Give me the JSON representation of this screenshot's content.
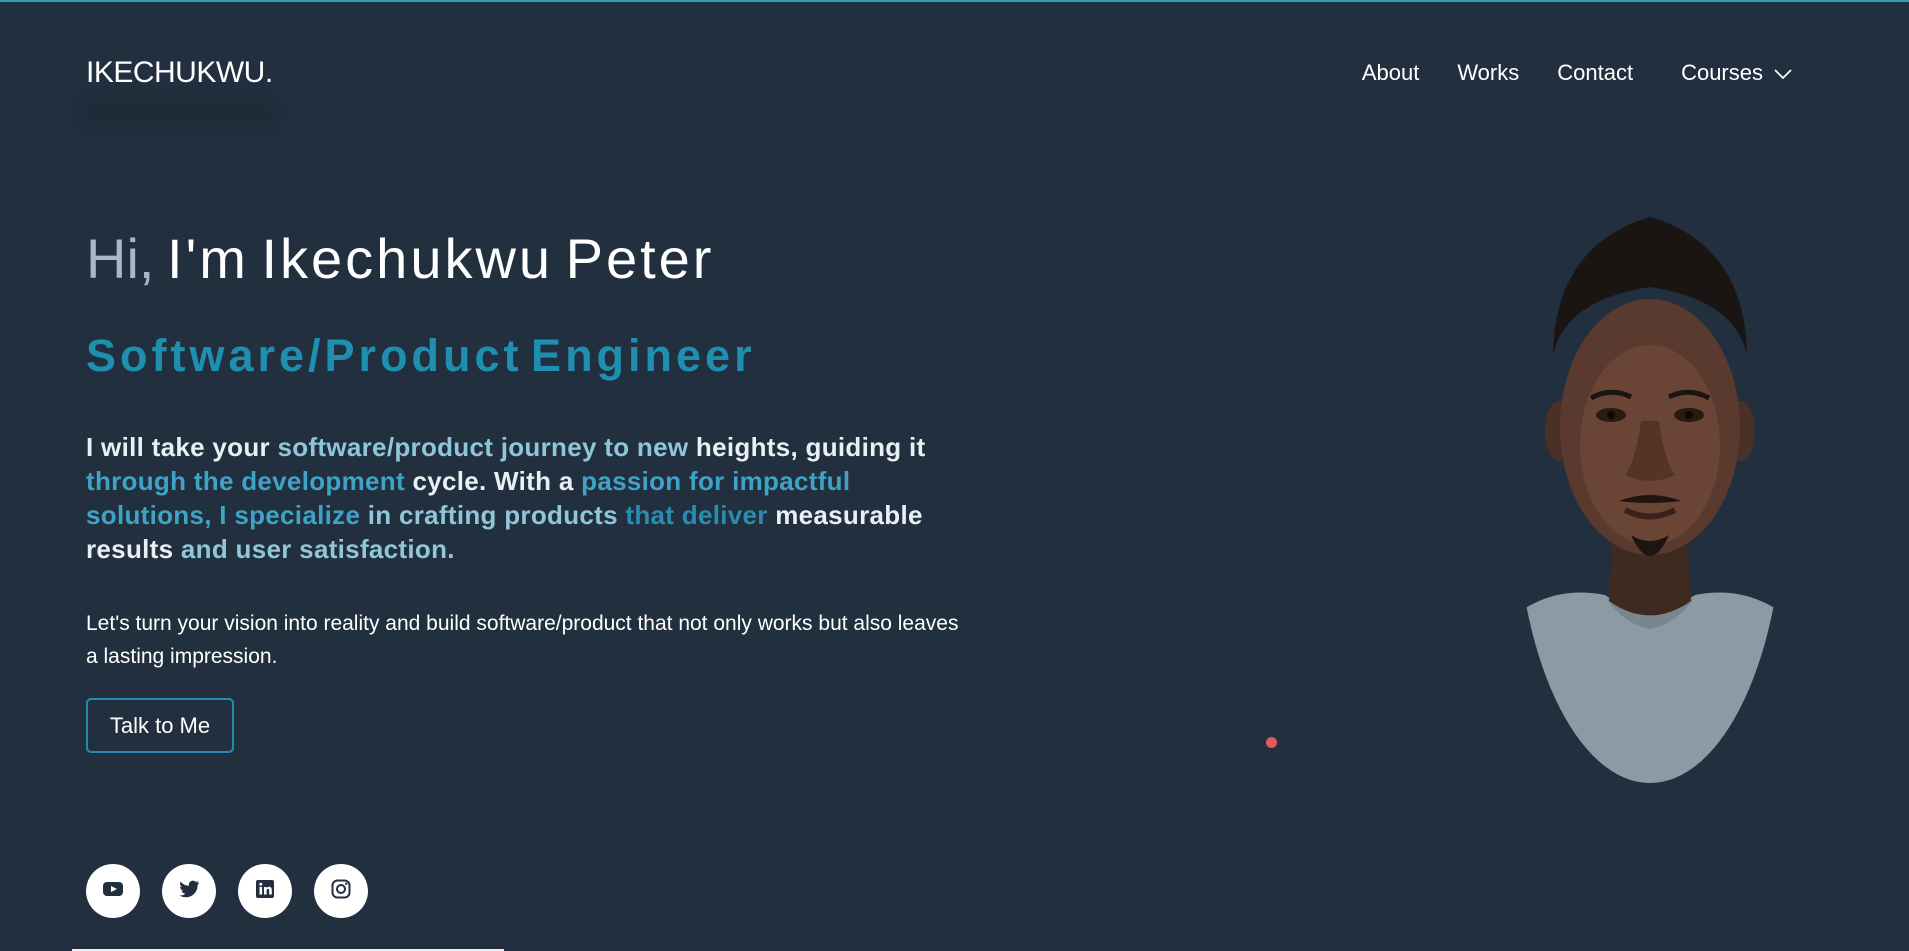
{
  "header": {
    "logo": "IKECHUKWU.",
    "nav": {
      "about": "About",
      "works": "Works",
      "contact": "Contact",
      "courses": "Courses"
    }
  },
  "hero": {
    "greeting": "Hi,",
    "intro": "I'm Ikechukwu Peter",
    "role": "Software/Product Engineer",
    "lead": [
      {
        "t": "I will take your ",
        "c": "w"
      },
      {
        "t": "software/product journey ",
        "c": "b1"
      },
      {
        "t": "to new ",
        "c": "b1"
      },
      {
        "t": "heights, guiding it ",
        "c": "w"
      },
      {
        "t": "through the development ",
        "c": "b2"
      },
      {
        "t": "cycle. With a ",
        "c": "w"
      },
      {
        "t": "passion for impactful solutions, I specialize ",
        "c": "b2"
      },
      {
        "t": "in crafting products ",
        "c": "b1"
      },
      {
        "t": "that deliver ",
        "c": "b3"
      },
      {
        "t": "measurable results ",
        "c": "w"
      },
      {
        "t": "and user satisfaction.",
        "c": "b1"
      }
    ],
    "sub": "Let's turn your vision into reality and build software/product that not only works but also leaves a lasting impression.",
    "cta": "Talk to Me"
  },
  "socials": [
    "youtube-icon",
    "twitter-icon",
    "linkedin-icon",
    "instagram-icon"
  ],
  "colors": {
    "background": "#222f3e",
    "accent": "#1f8fb0",
    "greeting": "#a8b8c4",
    "dot": "#e05a5a"
  }
}
